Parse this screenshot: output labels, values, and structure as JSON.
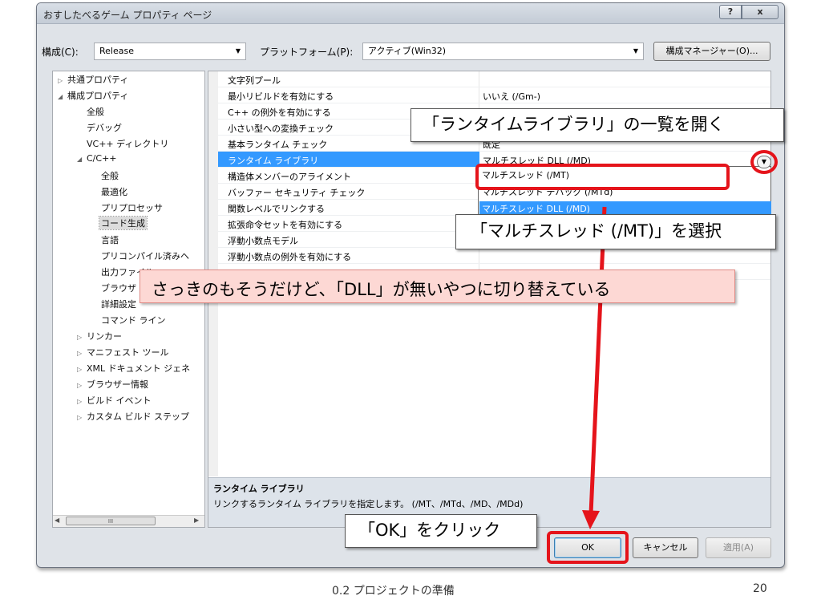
{
  "window": {
    "title": "おすしたべるゲーム プロパティ ページ",
    "help_label": "?",
    "close_label": "x"
  },
  "top": {
    "config_label": "構成(C):",
    "config_value": "Release",
    "platform_label": "プラットフォーム(P):",
    "platform_value": "アクティブ(Win32)",
    "config_manager_label": "構成マネージャー(O)..."
  },
  "tree": {
    "items": [
      {
        "label": "共通プロパティ",
        "toggle": "▷"
      },
      {
        "label": "構成プロパティ",
        "toggle": "◢"
      },
      {
        "label": "全般"
      },
      {
        "label": "デバッグ"
      },
      {
        "label": "VC++ ディレクトリ"
      },
      {
        "label": "C/C++",
        "toggle": "◢"
      },
      {
        "label": "全般"
      },
      {
        "label": "最適化"
      },
      {
        "label": "プリプロセッサ"
      },
      {
        "label": "コード生成"
      },
      {
        "label": "言語"
      },
      {
        "label": "プリコンパイル済みヘ"
      },
      {
        "label": "出力ファイル"
      },
      {
        "label": "ブラウザ"
      },
      {
        "label": "詳細設定"
      },
      {
        "label": "コマンド ライン"
      },
      {
        "label": "リンカー",
        "toggle": "▷"
      },
      {
        "label": "マニフェスト ツール",
        "toggle": "▷"
      },
      {
        "label": "XML ドキュメント ジェネ",
        "toggle": "▷"
      },
      {
        "label": "ブラウザー情報",
        "toggle": "▷"
      },
      {
        "label": "ビルド イベント",
        "toggle": "▷"
      },
      {
        "label": "カスタム ビルド ステップ",
        "toggle": "▷"
      }
    ],
    "scroll_thumb": "III"
  },
  "grid": {
    "rows": [
      {
        "name": "文字列プール",
        "value": ""
      },
      {
        "name": "最小リビルドを有効にする",
        "value": "いいえ (/Gm-)"
      },
      {
        "name": "C++ の例外を有効にする",
        "value": ""
      },
      {
        "name": "小さい型への変換チェック",
        "value": ""
      },
      {
        "name": "基本ランタイム チェック",
        "value": "既定"
      },
      {
        "name": "ランタイム ライブラリ",
        "value": "マルチスレッド DLL (/MD)"
      },
      {
        "name": "構造体メンバーのアライメント",
        "value": ""
      },
      {
        "name": "バッファー セキュリティ チェック",
        "value": ""
      },
      {
        "name": "関数レベルでリンクする",
        "value": ""
      },
      {
        "name": "拡張命令セットを有効にする",
        "value": ""
      },
      {
        "name": "浮動小数点モデル",
        "value": ""
      },
      {
        "name": "浮動小数点の例外を有効にする",
        "value": ""
      },
      {
        "name": "",
        "value": ""
      }
    ],
    "dropdown_options": [
      "マルチスレッド (/MT)",
      "マルチスレッド デバッグ (/MTd)",
      "マルチスレッド DLL (/MD)"
    ],
    "description_title": "ランタイム ライブラリ",
    "description_text": "リンクするランタイム ライブラリを指定します。   (/MT、/MTd、/MD、/MDd)"
  },
  "buttons": {
    "ok": "OK",
    "cancel": "キャンセル",
    "apply": "適用(A)"
  },
  "annotations": {
    "open_list": "「ランタイムライブラリ」の一覧を開く",
    "select_mt": "「マルチスレッド (/MT)」を選択",
    "note": "さっきのもそうだけど、「DLL」が無いやつに切り替えている",
    "click_ok": "「OK」をクリック"
  },
  "footer": {
    "chapter": "0.2 プロジェクトの準備",
    "page": "20"
  },
  "colors": {
    "annotation_red": "#e5141b",
    "selection_blue": "#3399ff",
    "note_pink": "#fdd8d4"
  }
}
